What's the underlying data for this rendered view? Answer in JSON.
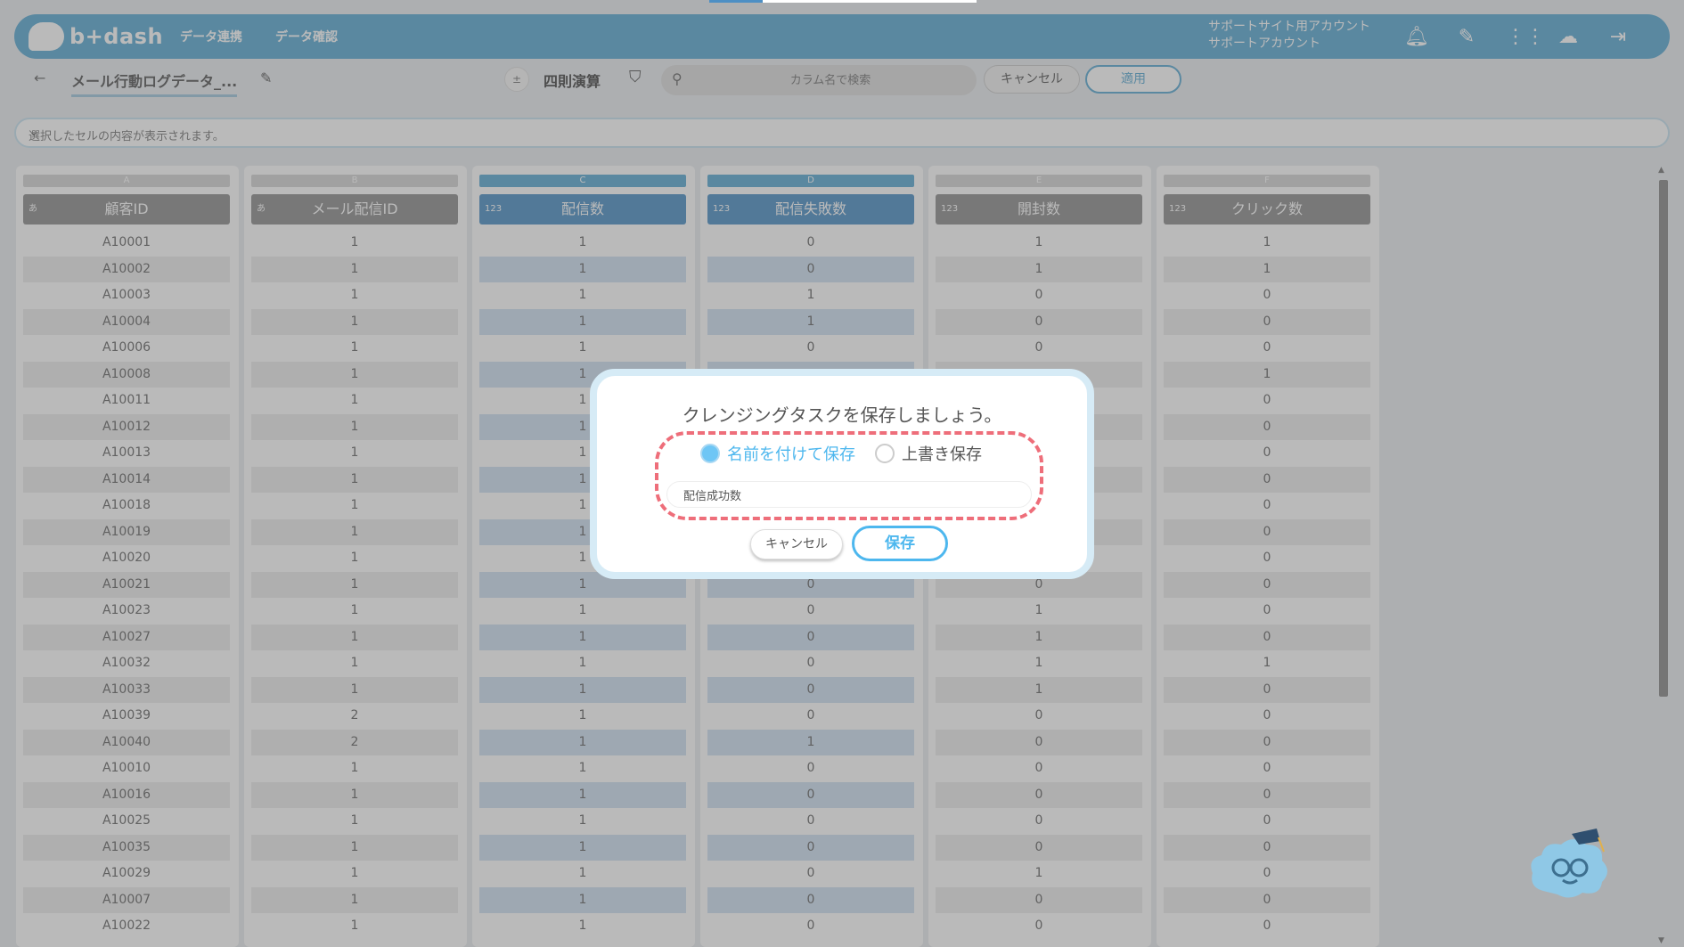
{
  "app": {
    "logo_text": "b+dash",
    "nav": [
      "データ連携",
      "データ確認"
    ],
    "account_line1": "サポートサイト用アカウント",
    "account_line2": "サポートアカウント"
  },
  "toolbar": {
    "title": "メール行動ログデータ_...",
    "calc_label": "四則演算",
    "search_placeholder": "カラム名で検索",
    "cancel_label": "キャンセル",
    "apply_label": "適用"
  },
  "cellbar": {
    "text": "選択したセルの内容が表示されます。"
  },
  "columns": [
    {
      "letter": "A",
      "type": "あ",
      "header": "顧客ID",
      "selected": false,
      "values": [
        "A10001",
        "A10002",
        "A10003",
        "A10004",
        "A10006",
        "A10008",
        "A10011",
        "A10012",
        "A10013",
        "A10014",
        "A10018",
        "A10019",
        "A10020",
        "A10021",
        "A10023",
        "A10027",
        "A10032",
        "A10033",
        "A10039",
        "A10040",
        "A10010",
        "A10016",
        "A10025",
        "A10035",
        "A10029",
        "A10007",
        "A10022"
      ]
    },
    {
      "letter": "B",
      "type": "あ",
      "header": "メール配信ID",
      "selected": false,
      "values": [
        "1",
        "1",
        "1",
        "1",
        "1",
        "1",
        "1",
        "1",
        "1",
        "1",
        "1",
        "1",
        "1",
        "1",
        "1",
        "1",
        "1",
        "1",
        "2",
        "2",
        "1",
        "1",
        "1",
        "1",
        "1",
        "1",
        "1"
      ]
    },
    {
      "letter": "C",
      "type": "123",
      "header": "配信数",
      "selected": true,
      "values": [
        "1",
        "1",
        "1",
        "1",
        "1",
        "1",
        "1",
        "1",
        "1",
        "1",
        "1",
        "1",
        "1",
        "1",
        "1",
        "1",
        "1",
        "1",
        "1",
        "1",
        "1",
        "1",
        "1",
        "1",
        "1",
        "1",
        "1"
      ]
    },
    {
      "letter": "D",
      "type": "123",
      "header": "配信失敗数",
      "selected": true,
      "values": [
        "0",
        "0",
        "1",
        "1",
        "0",
        "",
        "",
        "",
        "",
        "",
        "",
        "",
        "",
        "0",
        "0",
        "0",
        "0",
        "0",
        "0",
        "1",
        "0",
        "0",
        "0",
        "0",
        "0",
        "0",
        "0"
      ]
    },
    {
      "letter": "E",
      "type": "123",
      "header": "開封数",
      "selected": false,
      "values": [
        "1",
        "1",
        "0",
        "0",
        "0",
        "",
        "",
        "",
        "",
        "",
        "",
        "",
        "",
        "0",
        "1",
        "1",
        "1",
        "1",
        "0",
        "0",
        "0",
        "0",
        "0",
        "0",
        "1",
        "0",
        "0"
      ]
    },
    {
      "letter": "F",
      "type": "123",
      "header": "クリック数",
      "selected": false,
      "values": [
        "1",
        "1",
        "0",
        "0",
        "0",
        "1",
        "0",
        "0",
        "0",
        "0",
        "0",
        "0",
        "0",
        "0",
        "0",
        "0",
        "1",
        "0",
        "0",
        "0",
        "0",
        "0",
        "0",
        "0",
        "0",
        "0",
        "0"
      ]
    }
  ],
  "modal": {
    "title": "クレンジングタスクを保存しましょう。",
    "option_new": "名前を付けて保存",
    "option_overwrite": "上書き保存",
    "name_value": "配信成功数",
    "cancel_label": "キャンセル",
    "save_label": "保存"
  },
  "colors": {
    "brand": "#5aa9d3",
    "accent": "#4db7ee",
    "highlight": "#ee6e7a"
  }
}
